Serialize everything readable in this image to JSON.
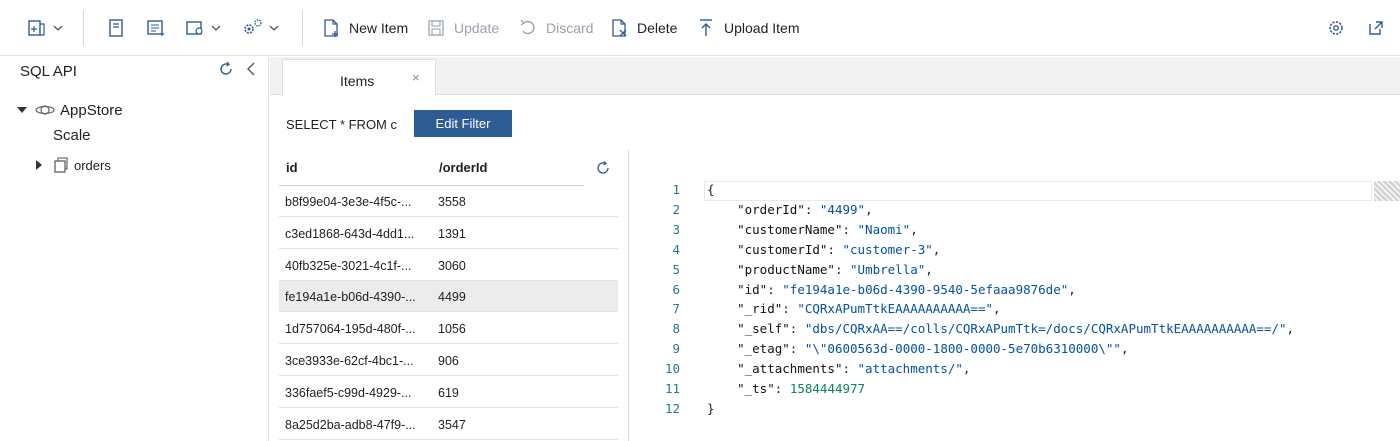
{
  "toolbar": {
    "new_item": "New Item",
    "update": "Update",
    "discard": "Discard",
    "delete": "Delete",
    "upload_item": "Upload Item"
  },
  "sidebar": {
    "title": "SQL API",
    "database": "AppStore",
    "scale": "Scale",
    "collection": "orders"
  },
  "tabs": [
    {
      "label": "Items",
      "close": "×"
    }
  ],
  "query": {
    "text": "SELECT * FROM c",
    "edit_filter": "Edit Filter"
  },
  "grid": {
    "headers": [
      "id",
      "/orderId"
    ],
    "rows": [
      {
        "id": "b8f99e04-3e3e-4f5c-...",
        "orderId": "3558"
      },
      {
        "id": "c3ed1868-643d-4dd1...",
        "orderId": "1391"
      },
      {
        "id": "40fb325e-3021-4c1f-...",
        "orderId": "3060"
      },
      {
        "id": "fe194a1e-b06d-4390-...",
        "orderId": "4499"
      },
      {
        "id": "1d757064-195d-480f-...",
        "orderId": "1056"
      },
      {
        "id": "3ce3933e-62cf-4bc1-...",
        "orderId": "906"
      },
      {
        "id": "336faef5-c99d-4929-...",
        "orderId": "619"
      },
      {
        "id": "8a25d2ba-adb8-47f9-...",
        "orderId": "3547"
      }
    ],
    "selected_index": 3
  },
  "document": {
    "line_numbers": [
      "1",
      "2",
      "3",
      "4",
      "5",
      "6",
      "7",
      "8",
      "9",
      "10",
      "11",
      "12"
    ],
    "lines": [
      "{",
      "    \"orderId\": \"4499\",",
      "    \"customerName\": \"Naomi\",",
      "    \"customerId\": \"customer-3\",",
      "    \"productName\": \"Umbrella\",",
      "    \"id\": \"fe194a1e-b06d-4390-9540-5efaaa9876de\",",
      "    \"_rid\": \"CQRxAPumTtkEAAAAAAAAAA==\",",
      "    \"_self\": \"dbs/CQRxAA==/colls/CQRxAPumTtk=/docs/CQRxAPumTtkEAAAAAAAAAA==/\",",
      "    \"_etag\": \"\\\"0600563d-0000-1800-0000-5e70b6310000\\\"\",",
      "    \"_attachments\": \"attachments/\",",
      "    \"_ts\": 1584444977",
      "}"
    ]
  },
  "colors": {
    "accent": "#2f5b94",
    "selected_row": "#ececec",
    "line_number": "#237893"
  }
}
